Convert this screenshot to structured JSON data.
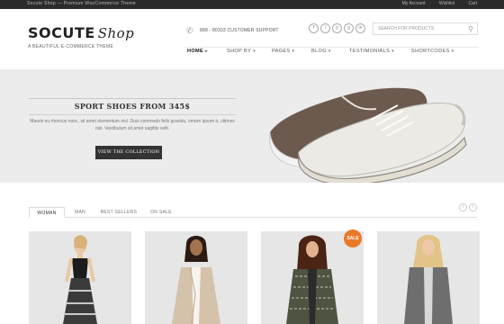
{
  "topbar": {
    "left_text": "Socute Shop — Premium WooCommerce Theme",
    "right_links": [
      "My Account",
      "Wishlist",
      "Cart"
    ]
  },
  "header": {
    "logo_main": "SOCUTE",
    "logo_script": "Shop",
    "tagline": "A BEAUTIFUL E-COMMERCE THEME",
    "support": "888 - 80333 CUSTOMER SUPPORT",
    "search_placeholder": "SEARCH FOR PRODUCTS",
    "socials": [
      "f",
      "t",
      "p",
      "g",
      "in"
    ]
  },
  "nav": {
    "items": [
      "HOME",
      "SHOP BY",
      "PAGES",
      "BLOG",
      "TESTIMONIALS",
      "SHORTCODES"
    ],
    "active_index": 0
  },
  "hero": {
    "title": "SPORT SHOES FROM 345$",
    "text": "Mauris eu rhoncus nunc, sit amet elementum nisl. Duis commodo felis gravida, ornare ipsum a, ultrices nisl. Vestibulum sit amet sagittis velit.",
    "button": "VIEW THE COLLECTION"
  },
  "tabs": {
    "items": [
      "WOMAN",
      "MAN",
      "BEST SELLERS",
      "ON SALE"
    ],
    "active_index": 0
  },
  "products": {
    "sale_badge": "SALE"
  },
  "colors": {
    "accent": "#e8792b",
    "dark": "#2b2b2b",
    "hero_bg": "#ececec"
  }
}
